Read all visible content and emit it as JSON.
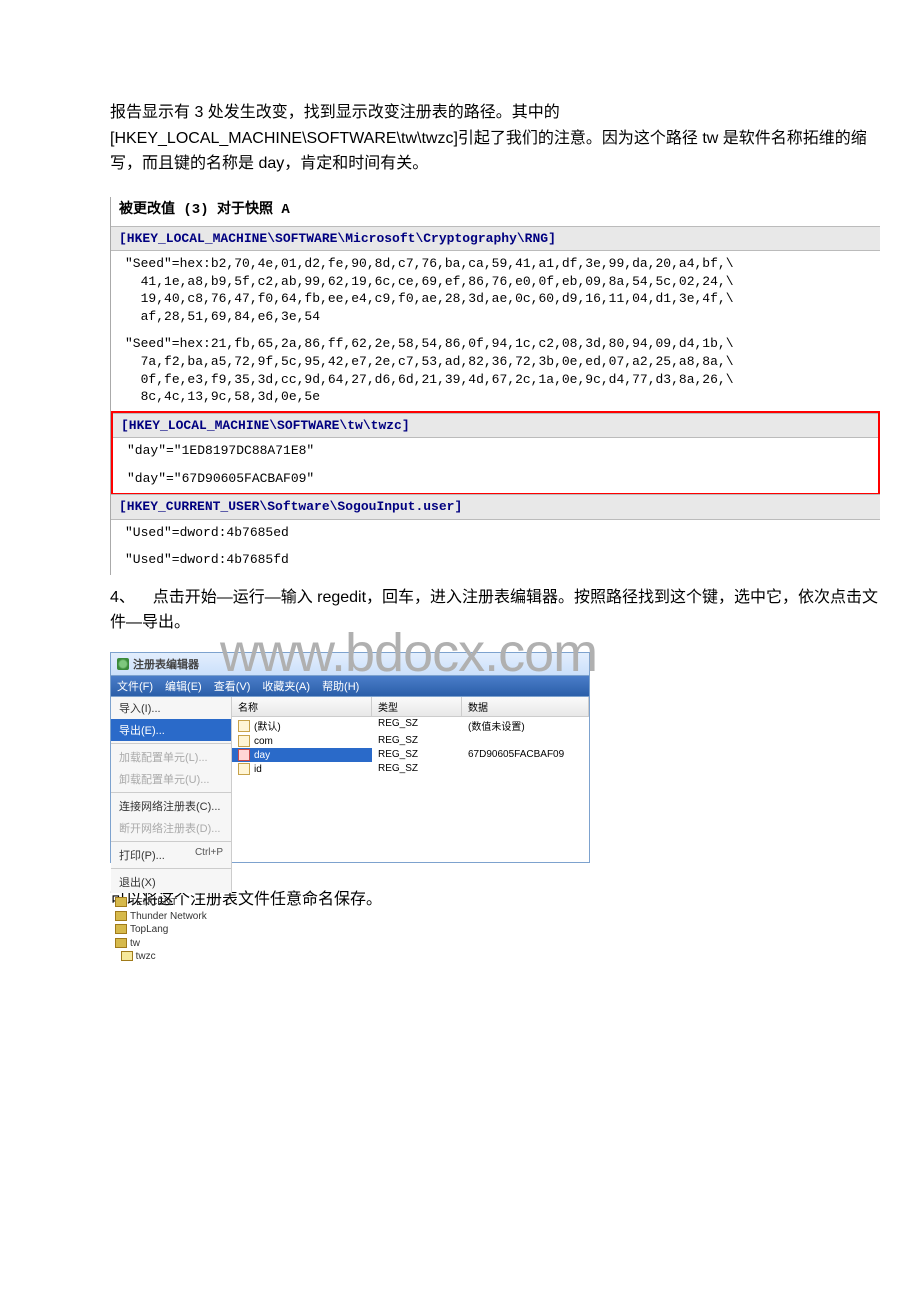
{
  "intro": {
    "p1": "报告显示有 3 处发生改变，找到显示改变注册表的路径。其中的[HKEY_LOCAL_MACHINE\\SOFTWARE\\tw\\twzc]引起了我们的注意。因为这个路径 tw 是软件名称拓维的缩写，而且键的名称是 day，肯定和时间有关。"
  },
  "report": {
    "heading": "被更改值 (3) 对于快照 A",
    "key1": "[HKEY_LOCAL_MACHINE\\SOFTWARE\\Microsoft\\Cryptography\\RNG]",
    "val1a": "\"Seed\"=hex:b2,70,4e,01,d2,fe,90,8d,c7,76,ba,ca,59,41,a1,df,3e,99,da,20,a4,bf,\\\n  41,1e,a8,b9,5f,c2,ab,99,62,19,6c,ce,69,ef,86,76,e0,0f,eb,09,8a,54,5c,02,24,\\\n  19,40,c8,76,47,f0,64,fb,ee,e4,c9,f0,ae,28,3d,ae,0c,60,d9,16,11,04,d1,3e,4f,\\\n  af,28,51,69,84,e6,3e,54",
    "val1b": "\"Seed\"=hex:21,fb,65,2a,86,ff,62,2e,58,54,86,0f,94,1c,c2,08,3d,80,94,09,d4,1b,\\\n  7a,f2,ba,a5,72,9f,5c,95,42,e7,2e,c7,53,ad,82,36,72,3b,0e,ed,07,a2,25,a8,8a,\\\n  0f,fe,e3,f9,35,3d,cc,9d,64,27,d6,6d,21,39,4d,67,2c,1a,0e,9c,d4,77,d3,8a,26,\\\n  8c,4c,13,9c,58,3d,0e,5e",
    "key2": "[HKEY_LOCAL_MACHINE\\SOFTWARE\\tw\\twzc]",
    "val2a": "\"day\"=\"1ED8197DC88A71E8\"",
    "val2b": "\"day\"=\"67D90605FACBAF09\"",
    "key3": "[HKEY_CURRENT_USER\\Software\\SogouInput.user]",
    "val3a": "\"Used\"=dword:4b7685ed",
    "val3b": "\"Used\"=dword:4b7685fd"
  },
  "step": {
    "num": "4、",
    "text": "点击开始—运行—输入 regedit，回车，进入注册表编辑器。按照路径找到这个键，选中它，依次点击文件—导出。"
  },
  "regedit": {
    "watermark": "www.bdocx.com",
    "title": "注册表编辑器",
    "menubar": [
      "文件(F)",
      "编辑(E)",
      "查看(V)",
      "收藏夹(A)",
      "帮助(H)"
    ],
    "dropdown": {
      "import": "导入(I)...",
      "export": "导出(E)...",
      "load": "加载配置单元(L)...",
      "unload": "卸载配置单元(U)...",
      "connect": "连接网络注册表(C)...",
      "disconnect": "断开网络注册表(D)...",
      "print": "打印(P)...",
      "print_sc": "Ctrl+P",
      "exit": "退出(X)"
    },
    "tree": {
      "t1": "TENCENT",
      "t2": "Thunder Network",
      "t3": "TopLang",
      "t4": "tw",
      "t5": "twzc"
    },
    "columns": {
      "name": "名称",
      "type": "类型",
      "data": "数据"
    },
    "rows": [
      {
        "name": "(默认)",
        "type": "REG_SZ",
        "data": "(数值未设置)"
      },
      {
        "name": "com",
        "type": "REG_SZ",
        "data": ""
      },
      {
        "name": "day",
        "type": "REG_SZ",
        "data": "67D90605FACBAF09"
      },
      {
        "name": "id",
        "type": "REG_SZ",
        "data": ""
      }
    ]
  },
  "outro": "可以将这个注册表文件任意命名保存。"
}
